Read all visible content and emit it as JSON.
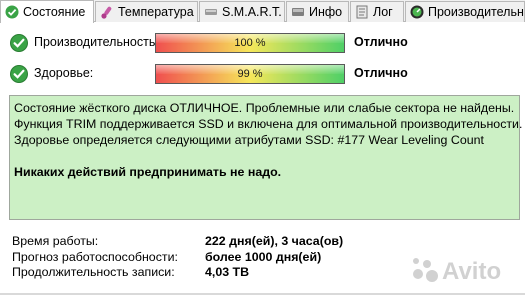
{
  "tabs": [
    {
      "label": "Состояние",
      "icon": "health-check-icon",
      "active": true
    },
    {
      "label": "Температура",
      "icon": "thermometer-icon",
      "active": false
    },
    {
      "label": "S.M.A.R.T.",
      "icon": "disk-icon",
      "active": false
    },
    {
      "label": "Инфо",
      "icon": "info-icon",
      "active": false
    },
    {
      "label": "Лог",
      "icon": "log-icon",
      "active": false
    },
    {
      "label": "Производительно",
      "icon": "speedometer-icon",
      "active": false
    }
  ],
  "performance": {
    "label": "Производительность:",
    "percent_text": "100 %",
    "value": 100,
    "status": "Отлично"
  },
  "health": {
    "label": "Здоровье:",
    "percent_text": "99 %",
    "value": 99,
    "status": "Отлично"
  },
  "message": {
    "line1": "Состояние жёсткого диска ОТЛИЧНОЕ. Проблемные или слабые сектора не найдены.",
    "line2": "Функция TRIM поддерживается SSD и включена для оптимальной производительности.",
    "line3": "Здоровье определяется следующими атрибутами SSD: #177 Wear Leveling Count",
    "advice": "Никаких действий предпринимать не надо."
  },
  "info": [
    {
      "key": "Время работы:",
      "value": "222 дня(ей), 3 часа(ов)"
    },
    {
      "key": "Прогноз работоспособности:",
      "value": "более 1000 дня(ей)"
    },
    {
      "key": "Продолжительность записи:",
      "value": "4,03 TB"
    }
  ],
  "watermark": "Avito",
  "colors": {
    "message_bg": "#ccf0c5",
    "check_green": "#3aa346",
    "bar_red": "#f04f4f",
    "bar_yellow": "#f6e75a",
    "bar_green": "#4fd067"
  }
}
